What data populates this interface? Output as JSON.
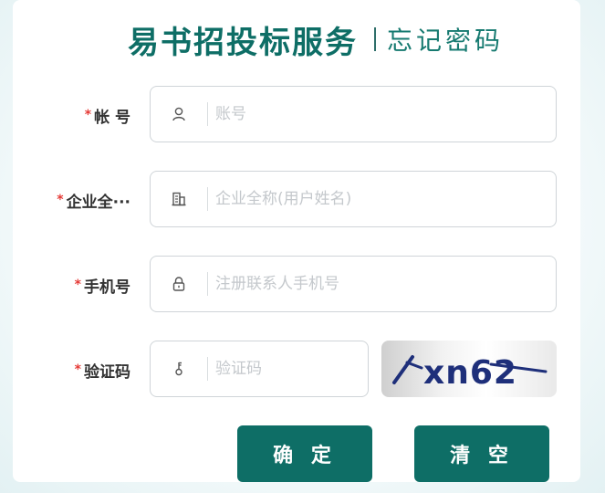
{
  "header": {
    "title": "易书招投标服务",
    "subtitle": "忘记密码"
  },
  "fields": [
    {
      "label": "帐 号",
      "icon": "user-icon",
      "placeholder": "账号",
      "value": "",
      "required": true
    },
    {
      "label": "企业全···",
      "icon": "building-icon",
      "placeholder": "企业全称(用户姓名)",
      "value": "",
      "required": true
    },
    {
      "label": "手机号",
      "icon": "lock-icon",
      "placeholder": "注册联系人手机号",
      "value": "",
      "required": true
    },
    {
      "label": "验证码",
      "icon": "key-icon",
      "placeholder": "验证码",
      "value": "",
      "required": true
    }
  ],
  "captcha": {
    "text": "xn62"
  },
  "buttons": {
    "confirm": "确 定",
    "clear": "清 空"
  },
  "required_mark": "*",
  "colors": {
    "brand": "#0e6e66",
    "required": "#e53935",
    "border": "#cfd4d8",
    "placeholder": "#c4c8cc"
  }
}
